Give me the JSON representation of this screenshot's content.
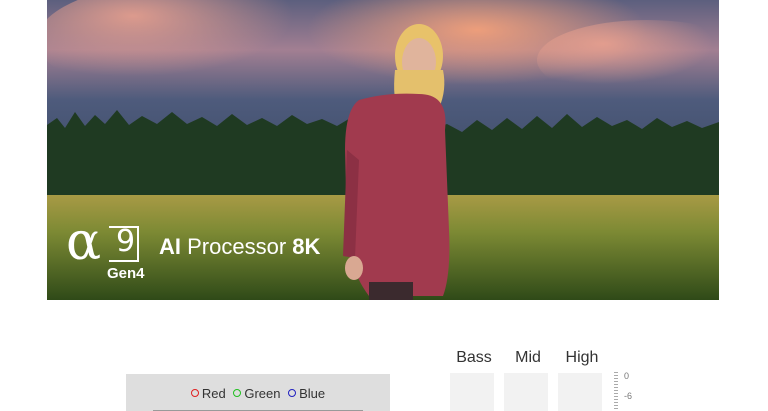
{
  "hero": {
    "brand_symbol": "α",
    "brand_number": "9",
    "generation": "Gen4",
    "processor_ai": "AI",
    "processor_word": "Processor",
    "processor_res": "8K"
  },
  "legend": {
    "items": [
      {
        "label": "Red",
        "color": "#e02020"
      },
      {
        "label": "Green",
        "color": "#20c020"
      },
      {
        "label": "Blue",
        "color": "#2020c0"
      }
    ]
  },
  "equalizer": {
    "bands": [
      "Bass",
      "Mid",
      "High"
    ],
    "scale": [
      "0",
      "-6"
    ]
  }
}
